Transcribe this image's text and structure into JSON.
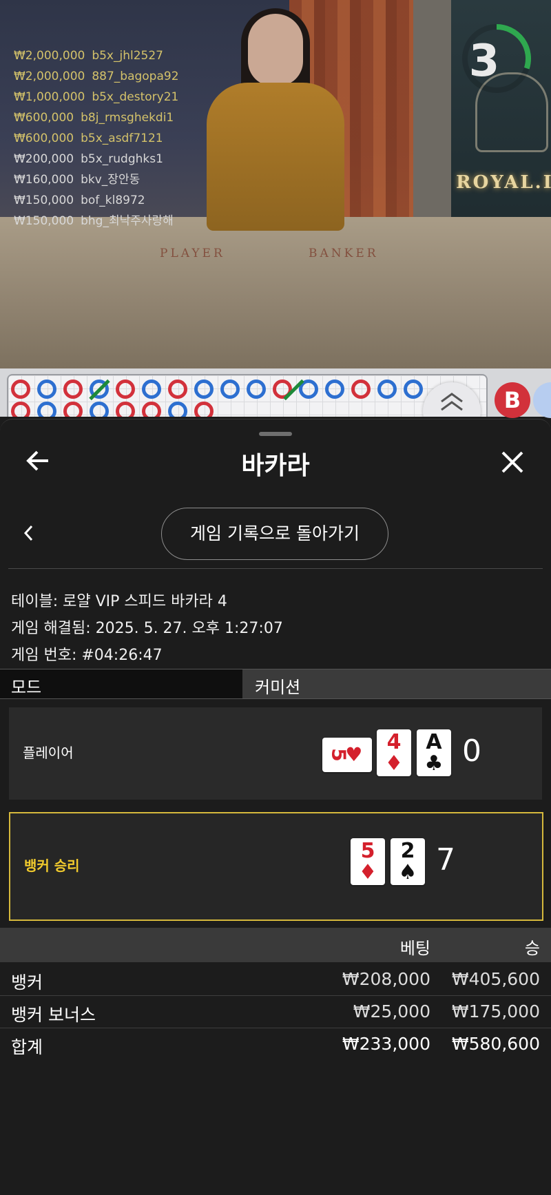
{
  "bet_feed": [
    {
      "amount": "₩2,000,000",
      "user": "b5x_jhl2527",
      "tone": "hi"
    },
    {
      "amount": "₩2,000,000",
      "user": "887_bagopa92",
      "tone": "hi"
    },
    {
      "amount": "₩1,000,000",
      "user": "b5x_destory21",
      "tone": "hi"
    },
    {
      "amount": "₩600,000",
      "user": "b8j_rmsghekdi1",
      "tone": "hi"
    },
    {
      "amount": "₩600,000",
      "user": "b5x_asdf7121",
      "tone": "hi"
    },
    {
      "amount": "₩200,000",
      "user": "b5x_rudghks1",
      "tone": "lo"
    },
    {
      "amount": "₩160,000",
      "user": "bkv_장안동",
      "tone": "lo"
    },
    {
      "amount": "₩150,000",
      "user": "bof_kl8972",
      "tone": "lo"
    },
    {
      "amount": "₩150,000",
      "user": "bhg_최낙주사랑해",
      "tone": "lo"
    }
  ],
  "countdown": {
    "value": "3",
    "progress": 0.3,
    "color": "#2fa84f"
  },
  "table_print": {
    "player": "PLAYER",
    "banker": "BANKER",
    "brand": "ROYAL.I"
  },
  "roadmap": {
    "badge": "B"
  },
  "sheet": {
    "title": "바카라",
    "back_icon": "arrow-left-icon",
    "close_icon": "close-icon",
    "history_button": "게임 기록으로 돌아가기",
    "info": {
      "table": "테이블: 로얄 VIP 스피드 바카라 4",
      "resolved": "게임 해결됨: 2025. 5. 27. 오후 1:27:07",
      "game_no": "게임 번호: #04:26:47"
    },
    "mode_label": "모드",
    "commission_label": "커미션",
    "player": {
      "label": "플레이어",
      "side_card": {
        "rank": "5",
        "suit": "♥"
      },
      "cards": [
        {
          "rank": "4",
          "suit": "♦",
          "color": "red"
        },
        {
          "rank": "A",
          "suit": "♣",
          "color": "black"
        }
      ],
      "score": "0"
    },
    "banker": {
      "label": "뱅커 승리",
      "label_color": "#f2cb2d",
      "cards": [
        {
          "rank": "5",
          "suit": "♦",
          "color": "red"
        },
        {
          "rank": "2",
          "suit": "♠",
          "color": "black"
        }
      ],
      "score": "7"
    },
    "table": {
      "headers": {
        "bet": "베팅",
        "win": "승"
      },
      "rows": [
        {
          "name": "뱅커",
          "bet": "₩208,000",
          "win": "₩405,600"
        },
        {
          "name": "뱅커 보너스",
          "bet": "₩25,000",
          "win": "₩175,000"
        },
        {
          "name": "합계",
          "bet": "₩233,000",
          "win": "₩580,600"
        }
      ]
    }
  },
  "colors": {
    "accent_gold": "#d6b93c",
    "player_blue": "#2d6fd0",
    "banker_red": "#d2313b"
  }
}
